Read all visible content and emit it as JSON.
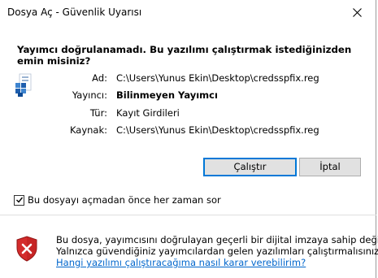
{
  "window": {
    "title": "Dosya Aç - Güvenlik Uyarısı"
  },
  "heading": "Yayımcı doğrulanamadı. Bu yazılımı çalıştırmak istediğinizden emin misiniz?",
  "details": [
    {
      "label": "Ad:",
      "value": "C:\\Users\\Yunus Ekin\\Desktop\\credsspfix.reg",
      "bold": false
    },
    {
      "label": "Yayıncı:",
      "value": "Bilinmeyen Yayımcı",
      "bold": true
    },
    {
      "label": "Tür:",
      "value": "Kayıt Girdileri",
      "bold": false
    },
    {
      "label": "Kaynak:",
      "value": "C:\\Users\\Yunus Ekin\\Desktop\\credsspfix.reg",
      "bold": false
    }
  ],
  "buttons": {
    "run_label": "Çalıştır",
    "cancel_label": "İptal"
  },
  "checkbox": {
    "label": "Bu dosyayı açmadan önce her zaman sor",
    "checked": true
  },
  "warning": {
    "line1": "Bu dosya, yayımcısını doğrulayan geçerli bir dijital imzaya sahip değil.",
    "line2": "Yalnızca güvendiğiniz yayımcılardan gelen yazılımları çalıştırmalısınız.",
    "link": "Hangi yazılımı çalıştıracağıma nasıl karar verebilirim?"
  },
  "colors": {
    "accent": "#0078d7",
    "link": "#0066cc",
    "shield_red": "#d42c2c"
  },
  "icons": {
    "close": "close-icon",
    "file": "registry-file-icon",
    "checkbox": "checkmark-icon",
    "shield": "shield-error-icon"
  }
}
